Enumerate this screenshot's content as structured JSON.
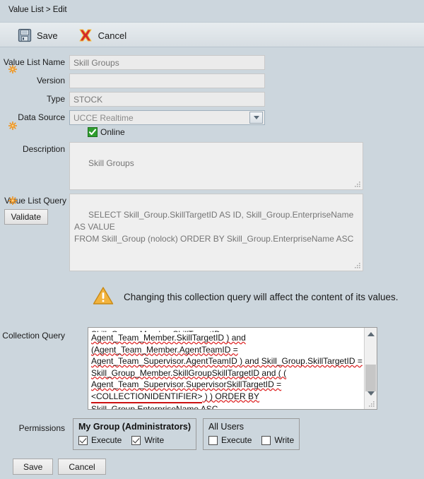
{
  "breadcrumb": "Value List > Edit",
  "toolbar": {
    "save_label": "Save",
    "cancel_label": "Cancel"
  },
  "form": {
    "value_list_name": {
      "label": "Value List Name",
      "value": "Skill Groups",
      "required": true
    },
    "version": {
      "label": "Version",
      "value": "",
      "required": false
    },
    "type": {
      "label": "Type",
      "value": "STOCK",
      "required": false
    },
    "data_source": {
      "label": "Data Source",
      "value": "UCCE Realtime",
      "required": true
    },
    "online": {
      "label": "Online",
      "checked": true
    },
    "description": {
      "label": "Description",
      "value": "Skill Groups"
    },
    "value_list_query": {
      "label": "Value List Query",
      "validate_label": "Validate",
      "required": true,
      "value": "SELECT Skill_Group.SkillTargetID AS ID, Skill_Group.EnterpriseName AS VALUE\nFROM Skill_Group (nolock) ORDER BY Skill_Group.EnterpriseName ASC"
    },
    "collection_query": {
      "label": "Collection Query",
      "lines": [
        "Agent_Team_Member.SkillTargetID ) and",
        "(Agent_Team_Member.AgentTeamID =",
        "Agent_Team_Supervisor.AgentTeamID ) and Skill_Group.SkillTargetID =",
        "Skill_Group_Member.SkillGroupSkillTargetID and  ( (",
        "Agent_Team_Supervisor.SupervisorSkillTargetID =",
        "<COLLECTIONIDENTIFIER> ) ) ORDER BY",
        "Skill_Group.EnterpriseName ASC"
      ],
      "clipped_top_line": "Skill_Group_Member.SkillTargetID ="
    }
  },
  "warning": {
    "icon": "warning-triangle-icon",
    "text": "Changing this collection query will affect the content of its values."
  },
  "permissions": {
    "label": "Permissions",
    "groups": [
      {
        "name": "My Group (Administrators)",
        "bold": true,
        "options": [
          {
            "label": "Execute",
            "checked": true
          },
          {
            "label": "Write",
            "checked": true
          }
        ]
      },
      {
        "name": "All Users",
        "bold": false,
        "options": [
          {
            "label": "Execute",
            "checked": false
          },
          {
            "label": "Write",
            "checked": false
          }
        ]
      }
    ]
  },
  "footer": {
    "save_label": "Save",
    "cancel_label": "Cancel"
  },
  "colors": {
    "page_background": "#ccd6dd",
    "toolbar_background": "#e0e6ea",
    "field_background": "#ebebeb",
    "required_marker": "#f0941e",
    "online_check": "#2f9e2f",
    "warning_amber": "#f2b33d",
    "cancel_red": "#d42a2a",
    "spellcheck_red": "#cc1111"
  }
}
